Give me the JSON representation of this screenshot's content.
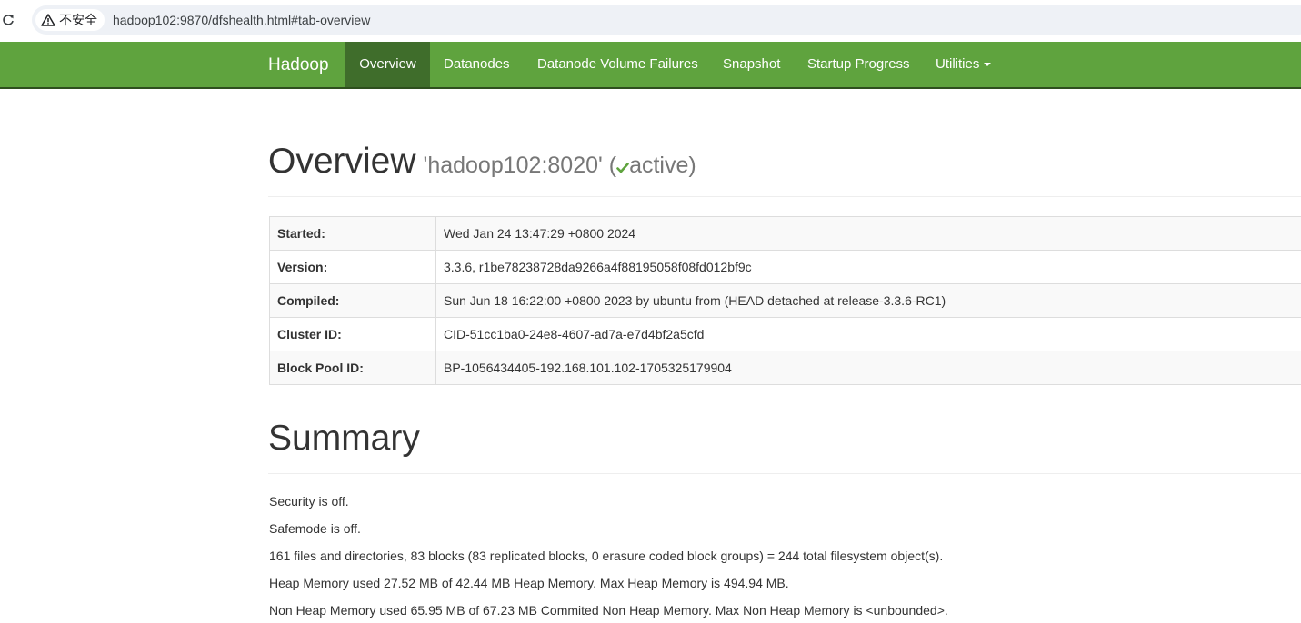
{
  "browser": {
    "security_label": "不安全",
    "url": "hadoop102:9870/dfshealth.html#tab-overview",
    "icons": [
      "reload-icon",
      "warning-icon"
    ]
  },
  "navbar": {
    "brand": "Hadoop",
    "color": "#5fa33e",
    "active_color": "#3f6d2b",
    "items": [
      {
        "label": "Overview",
        "active": true
      },
      {
        "label": "Datanodes",
        "active": false
      },
      {
        "label": "Datanode Volume Failures",
        "active": false
      },
      {
        "label": "Snapshot",
        "active": false
      },
      {
        "label": "Startup Progress",
        "active": false
      },
      {
        "label": "Utilities",
        "active": false,
        "dropdown": true
      }
    ]
  },
  "overview": {
    "title": "Overview",
    "host": "'hadoop102:8020'",
    "paren_open": "(",
    "state": "active",
    "paren_close": ")",
    "state_icon": "check-icon",
    "state_icon_color": "#5fa33e",
    "rows": [
      {
        "key": "Started:",
        "value": "Wed Jan 24 13:47:29 +0800 2024"
      },
      {
        "key": "Version:",
        "value": "3.3.6, r1be78238728da9266a4f88195058f08fd012bf9c"
      },
      {
        "key": "Compiled:",
        "value": "Sun Jun 18 16:22:00 +0800 2023 by ubuntu from (HEAD detached at release-3.3.6-RC1)"
      },
      {
        "key": "Cluster ID:",
        "value": "CID-51cc1ba0-24e8-4607-ad7a-e7d4bf2a5cfd"
      },
      {
        "key": "Block Pool ID:",
        "value": "BP-1056434405-192.168.101.102-1705325179904"
      }
    ]
  },
  "summary": {
    "title": "Summary",
    "lines": [
      "Security is off.",
      "Safemode is off.",
      "161 files and directories, 83 blocks (83 replicated blocks, 0 erasure coded block groups) = 244 total filesystem object(s).",
      "Heap Memory used 27.52 MB of 42.44 MB Heap Memory. Max Heap Memory is 494.94 MB.",
      "Non Heap Memory used 65.95 MB of 67.23 MB Commited Non Heap Memory. Max Non Heap Memory is <unbounded>."
    ]
  }
}
